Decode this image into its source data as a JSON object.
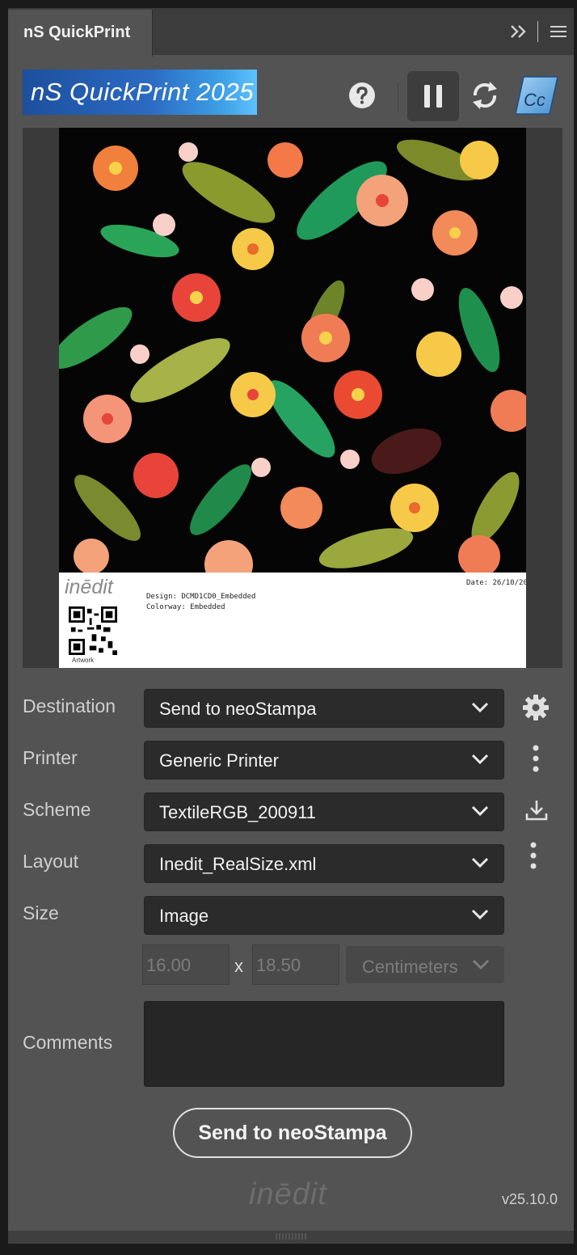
{
  "window": {
    "tab_title": "nS QuickPrint"
  },
  "header": {
    "logo_text": "nS QuickPrint 2025",
    "icons": [
      "help-icon",
      "pause-icon",
      "sync-icon",
      "adobe-cc-icon"
    ]
  },
  "preview": {
    "label": {
      "logo": "inēdit",
      "design_line": "Design: DCMD1CD0_Embedded",
      "colorway_line": "Colorway: Embedded",
      "date": "Date: 26/10/20",
      "qr_caption": "Artwork"
    }
  },
  "form": {
    "destination": {
      "label": "Destination",
      "value": "Send to neoStampa"
    },
    "printer": {
      "label": "Printer",
      "value": "Generic Printer"
    },
    "scheme": {
      "label": "Scheme",
      "value": "TextileRGB_200911"
    },
    "layout": {
      "label": "Layout",
      "value": "Inedit_RealSize.xml"
    },
    "size": {
      "label": "Size",
      "value": "Image"
    },
    "width": "16.00",
    "height": "18.50",
    "times": "x",
    "unit": "Centimeters",
    "comments_label": "Comments",
    "comments_value": ""
  },
  "actions": {
    "send_label": "Send to neoStampa"
  },
  "footer": {
    "logo": "inēdit",
    "version": "v25.10.0"
  },
  "colors": {
    "panel_bg": "#535353",
    "field_bg": "#2b2b2b",
    "logo_blue": "#2c6bc3"
  }
}
